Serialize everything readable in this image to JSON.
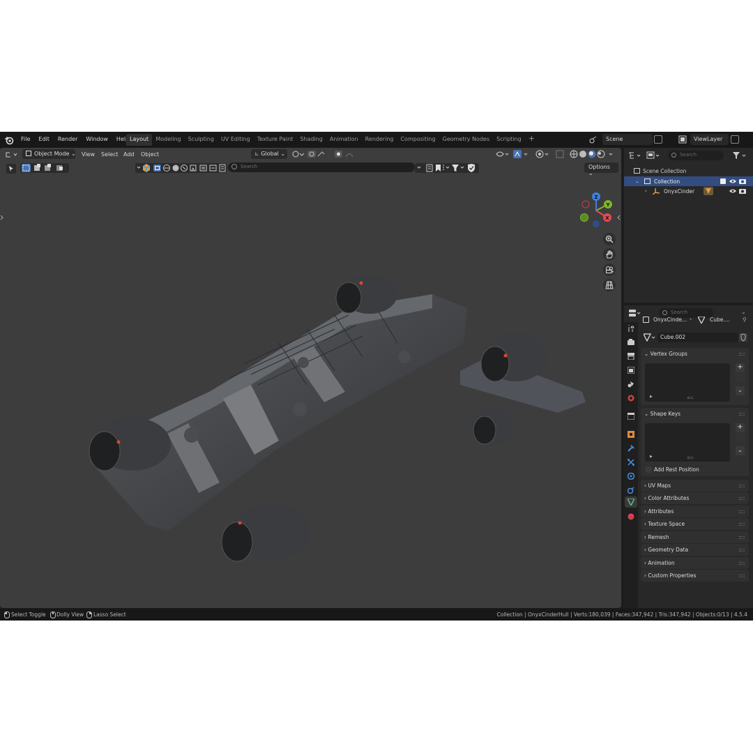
{
  "menu": [
    "File",
    "Edit",
    "Render",
    "Window",
    "Help"
  ],
  "workspaces": [
    "Layout",
    "Modeling",
    "Sculpting",
    "UV Editing",
    "Texture Paint",
    "Shading",
    "Animation",
    "Rendering",
    "Compositing",
    "Geometry Nodes",
    "Scripting"
  ],
  "active_workspace": "Layout",
  "scene": "Scene",
  "view_layer": "ViewLayer",
  "viewport": {
    "mode": "Object Mode",
    "menus": [
      "View",
      "Select",
      "Add",
      "Object"
    ],
    "transform_orientation": "Global",
    "search_placeholder": "Search",
    "options_label": "Options",
    "gizmo_axes": {
      "z": "Z",
      "y": "Y",
      "x": "X"
    }
  },
  "outliner": {
    "search_placeholder": "Search",
    "scene_collection": "Scene Collection",
    "collection": "Collection",
    "object": "OnyxCinder"
  },
  "properties": {
    "search_placeholder": "Search",
    "breadcrumb_object": "OnyxCinde...",
    "breadcrumb_data": "Cube....",
    "mesh_name": "Cube.002",
    "panels": {
      "vertex_groups": "Vertex Groups",
      "shape_keys": "Shape Keys",
      "add_rest_position": "Add Rest Position"
    },
    "collapsed_panels": [
      "UV Maps",
      "Color Attributes",
      "Attributes",
      "Texture Space",
      "Remesh",
      "Geometry Data",
      "Animation",
      "Custom Properties"
    ]
  },
  "status": {
    "hints": [
      "Select Toggle",
      "Dolly View",
      "Lasso Select"
    ],
    "info": "Collection | OnyxCinderHull | Verts:180,039 | Faces:347,942 | Tris:347,942 | Objects:0/13 | 4.5.4"
  },
  "colors": {
    "accent_blue": "#4772b3",
    "axis_x": "#e74a52",
    "axis_y": "#7fb52a",
    "axis_z": "#3f7fe0",
    "object_orange": "#e09a4a",
    "mesh_green": "#5fb38a"
  }
}
